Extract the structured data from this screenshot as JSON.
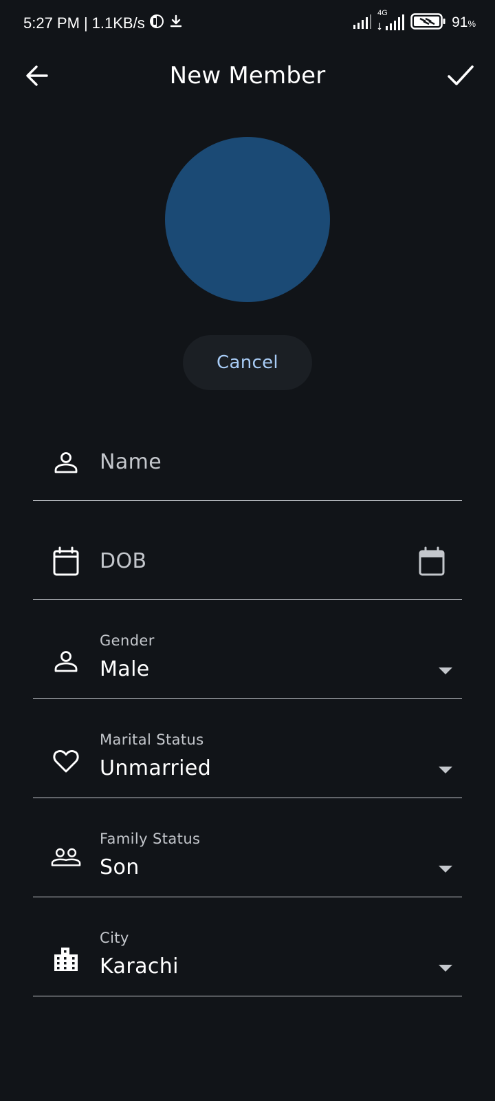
{
  "status_bar": {
    "time": "5:27 PM",
    "separator": "|",
    "net_speed": "1.1KB/s",
    "network_type": "4G",
    "battery_percent": "91",
    "battery_unit": "%"
  },
  "app_bar": {
    "title": "New Member"
  },
  "avatar": {
    "color": "#1b4a75"
  },
  "cancel_button": {
    "label": "Cancel"
  },
  "form": {
    "name": {
      "placeholder": "Name",
      "icon": "person-icon"
    },
    "dob": {
      "placeholder": "DOB",
      "icon": "calendar-icon",
      "trailing_icon": "calendar-picker-icon"
    },
    "gender": {
      "label": "Gender",
      "value": "Male",
      "icon": "person-icon"
    },
    "marital_status": {
      "label": "Marital Status",
      "value": "Unmarried",
      "icon": "heart-icon"
    },
    "family_status": {
      "label": "Family Status",
      "value": "Son",
      "icon": "group-icon"
    },
    "city": {
      "label": "City",
      "value": "Karachi",
      "icon": "building-icon"
    }
  },
  "colors": {
    "background": "#111418",
    "accent_text": "#a9cdf7",
    "avatar": "#1b4a75",
    "divider": "#c9ccd1"
  }
}
